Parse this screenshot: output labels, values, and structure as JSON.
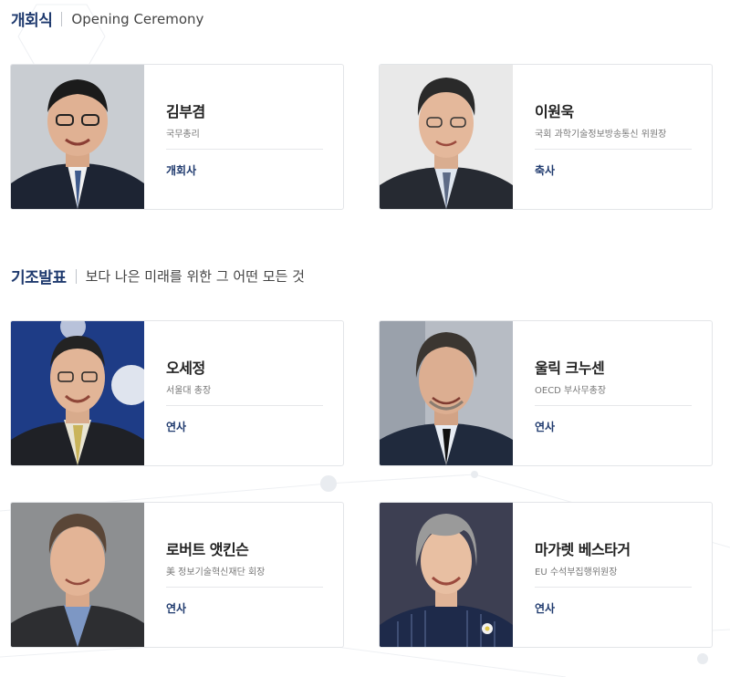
{
  "opening": {
    "title": "개회식",
    "subtitle": "Opening Ceremony",
    "speakers": [
      {
        "name": "김부겸",
        "role": "국무총리",
        "tag": "개회사"
      },
      {
        "name": "이원욱",
        "role": "국회 과학기술정보방송통신 위원장",
        "tag": "축사"
      }
    ]
  },
  "keynote": {
    "title": "기조발표",
    "subtitle": "보다 나은 미래를 위한 그 어떤 모든 것",
    "speakers": [
      {
        "name": "오세정",
        "role": "서울대 총장",
        "tag": "연사"
      },
      {
        "name": "울릭 크누센",
        "role": "OECD 부사무총장",
        "tag": "연사"
      },
      {
        "name": "로버트 앳킨슨",
        "role": "美 정보기술혁신재단 회장",
        "tag": "연사"
      },
      {
        "name": "마가렛 베스타거",
        "role": "EU 수석부집행위원장",
        "tag": "연사"
      }
    ]
  },
  "colors": {
    "accent": "#1f3a6e",
    "border": "#e3e5e8"
  }
}
